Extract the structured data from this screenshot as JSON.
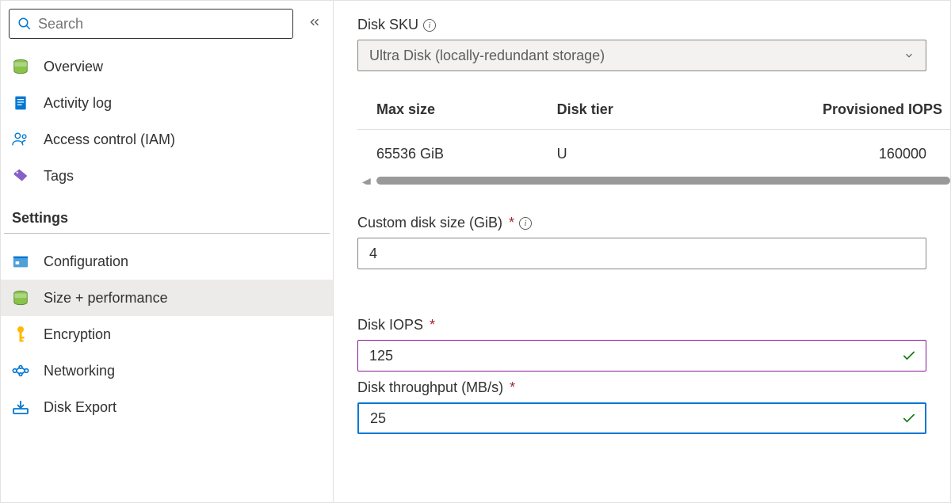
{
  "sidebar": {
    "search_placeholder": "Search",
    "items_top": [
      {
        "label": "Overview",
        "icon": "overview"
      },
      {
        "label": "Activity log",
        "icon": "activity"
      },
      {
        "label": "Access control (IAM)",
        "icon": "access"
      },
      {
        "label": "Tags",
        "icon": "tags"
      }
    ],
    "settings_header": "Settings",
    "items_settings": [
      {
        "label": "Configuration",
        "icon": "config"
      },
      {
        "label": "Size + performance",
        "icon": "size",
        "active": true
      },
      {
        "label": "Encryption",
        "icon": "encryption"
      },
      {
        "label": "Networking",
        "icon": "networking"
      },
      {
        "label": "Disk Export",
        "icon": "export"
      }
    ]
  },
  "main": {
    "disk_sku_label": "Disk SKU",
    "disk_sku_value": "Ultra Disk (locally-redundant storage)",
    "table": {
      "headers": [
        "Max size",
        "Disk tier",
        "Provisioned IOPS"
      ],
      "row": [
        "65536 GiB",
        "U",
        "160000"
      ]
    },
    "custom_size_label": "Custom disk size (GiB)",
    "custom_size_value": "4",
    "iops_label": "Disk IOPS",
    "iops_value": "125",
    "throughput_label": "Disk throughput (MB/s)",
    "throughput_value": "25"
  }
}
